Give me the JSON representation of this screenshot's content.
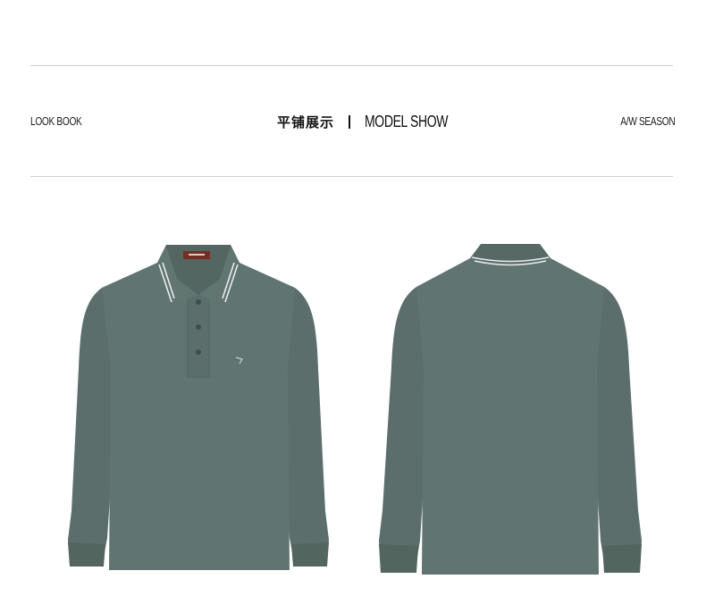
{
  "header": {
    "left_label": "LOOK BOOK",
    "center_cn": "平铺展示",
    "center_en": "MODEL SHOW",
    "right_label": "A/W SEASON"
  },
  "products": {
    "front_view": {
      "icon": "polo-front-icon"
    },
    "back_view": {
      "icon": "polo-back-icon"
    },
    "shirt_color": "#5f7370",
    "collar_stripe_color": "#e9ecea",
    "label_color": "#7a2b25"
  }
}
